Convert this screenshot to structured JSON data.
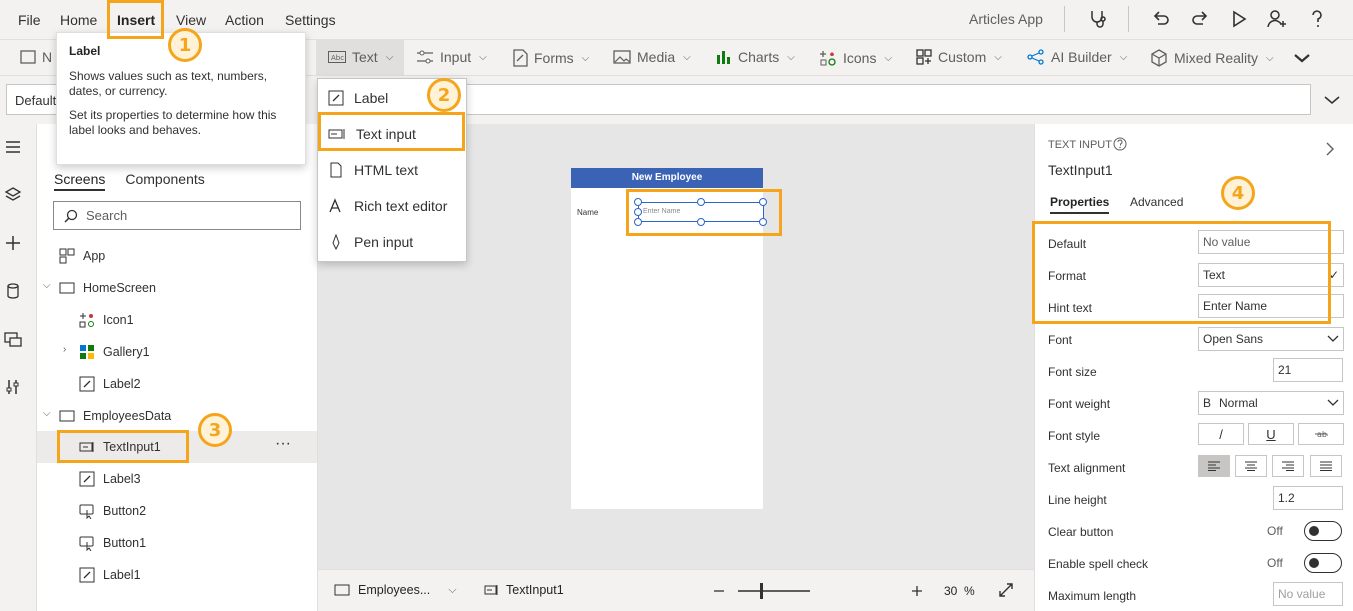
{
  "menu": {
    "items": [
      "File",
      "Home",
      "Insert",
      "View",
      "Action",
      "Settings"
    ],
    "app_name": "Articles App"
  },
  "ribbon": {
    "new_screen_partial": "N",
    "items": [
      "Text",
      "Input",
      "Forms",
      "Media",
      "Charts",
      "Icons",
      "Custom",
      "AI Builder",
      "Mixed Reality"
    ]
  },
  "formula_bar": {
    "property": "Default"
  },
  "tooltip": {
    "title": "Label",
    "p1": "Shows values such as text, numbers, dates, or currency.",
    "p2": "Set its properties to determine how this label looks and behaves."
  },
  "text_dropdown": {
    "items": [
      "Label",
      "Text input",
      "HTML text",
      "Rich text editor",
      "Pen input"
    ]
  },
  "tree": {
    "tabs": [
      "Screens",
      "Components"
    ],
    "search_placeholder": "Search",
    "nodes": [
      "App",
      "HomeScreen",
      "Icon1",
      "Gallery1",
      "Label2",
      "EmployeesData",
      "TextInput1",
      "Label3",
      "Button2",
      "Button1",
      "Label1"
    ],
    "more": "···"
  },
  "canvas": {
    "header": "New Employee",
    "name_label": "Name",
    "hint": "Enter Name"
  },
  "statusbar": {
    "screen": "Employees...",
    "control": "TextInput1",
    "zoom": "30",
    "zoom_unit": "%"
  },
  "properties": {
    "control_type": "TEXT INPUT",
    "control_name": "TextInput1",
    "tabs": [
      "Properties",
      "Advanced"
    ],
    "labels": [
      "Default",
      "Format",
      "Hint text",
      "Font",
      "Font size",
      "Font weight",
      "Font style",
      "Text alignment",
      "Line height",
      "Clear button",
      "Enable spell check",
      "Maximum length"
    ],
    "default_value": "No value",
    "format_value": "Text",
    "hint_value": "Enter Name",
    "font_value": "Open Sans",
    "font_size": "21",
    "font_weight_glyph": "B",
    "font_weight": "Normal",
    "style_italic": "/",
    "style_underline": "U",
    "line_height": "1.2",
    "off": "Off",
    "max_length": "No value"
  },
  "annotations": {
    "badges": [
      "1",
      "2",
      "3",
      "4"
    ],
    "color": "#f4a51c"
  },
  "colors": {
    "screen_header": "#3a62b5",
    "selection": "#2b67c7"
  }
}
